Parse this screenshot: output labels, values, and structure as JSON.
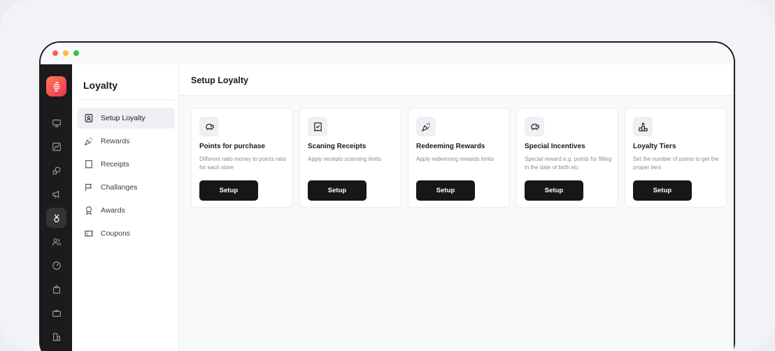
{
  "window": {
    "controls": [
      "close",
      "minimize",
      "maximize"
    ]
  },
  "rail": {
    "logo_icon": "stacked-bars-logo",
    "items": [
      {
        "icon": "presentation-icon",
        "active": false
      },
      {
        "icon": "chart-icon",
        "active": false
      },
      {
        "icon": "shapes-icon",
        "active": false
      },
      {
        "icon": "megaphone-icon",
        "active": false
      },
      {
        "icon": "medal-icon",
        "active": true
      },
      {
        "icon": "users-icon",
        "active": false
      },
      {
        "icon": "speedometer-icon",
        "active": false
      },
      {
        "icon": "shopping-bag-icon",
        "active": false
      },
      {
        "icon": "briefcase-icon",
        "active": false
      },
      {
        "icon": "buildings-icon",
        "active": false
      }
    ]
  },
  "subnav": {
    "title": "Loyalty",
    "items": [
      {
        "label": "Setup Loyalty",
        "icon": "badge-icon",
        "active": true
      },
      {
        "label": "Rewards",
        "icon": "confetti-icon",
        "active": false
      },
      {
        "label": "Receipts",
        "icon": "receipt-icon",
        "active": false
      },
      {
        "label": "Challanges",
        "icon": "flag-icon",
        "active": false
      },
      {
        "label": "Awards",
        "icon": "award-icon",
        "active": false
      },
      {
        "label": "Coupons",
        "icon": "ticket-icon",
        "active": false
      }
    ]
  },
  "main": {
    "title": "Setup Loyalty",
    "cards": [
      {
        "title": "Points for purchase",
        "description": "Different ratio money to points ratio for each store",
        "button": "Setup",
        "icon": "piggy-bank-icon"
      },
      {
        "title": "Scaning Receipts",
        "description": "Apply receipts scanning limits",
        "button": "Setup",
        "icon": "receipt-check-icon"
      },
      {
        "title": "Redeeming Rewards",
        "description": "Apply redeeming rewards limits",
        "button": "Setup",
        "icon": "confetti-icon"
      },
      {
        "title": "Special Incentives",
        "description": "Special reward e.g. points for filling in the date of birth etc",
        "button": "Setup",
        "icon": "piggy-bank-icon"
      },
      {
        "title": "Loyalty Tiers",
        "description": "Set the number of points to get the proper tiers",
        "button": "Setup",
        "icon": "podium-icon"
      }
    ]
  },
  "colors": {
    "accent_gradient_start": "#ff7b5a",
    "accent_gradient_end": "#e8344f",
    "rail_background": "#1b1b1d",
    "button_background": "#17171a"
  }
}
